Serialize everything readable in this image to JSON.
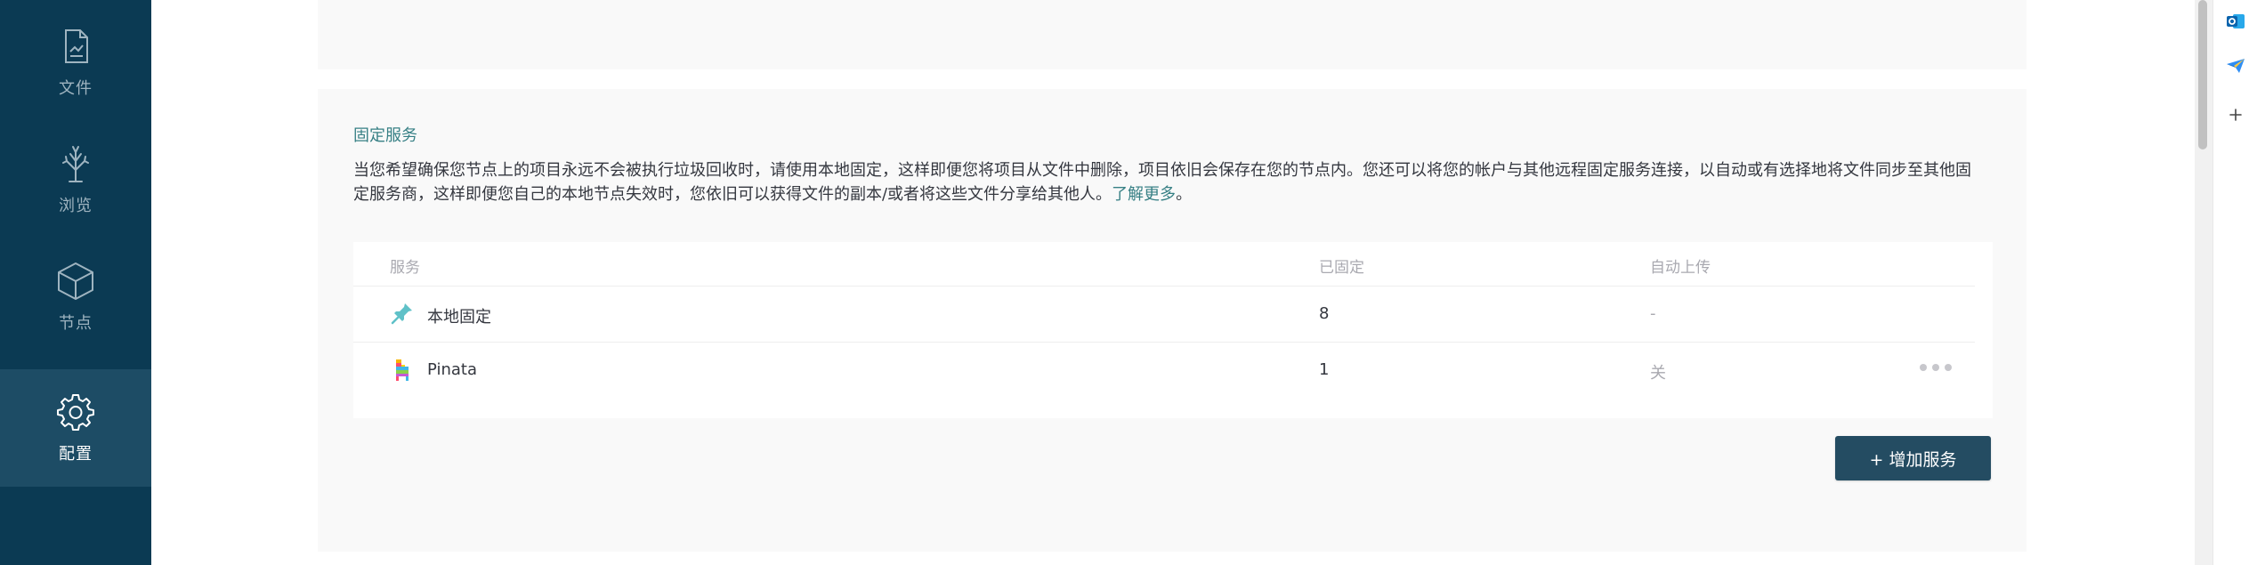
{
  "sidebar": {
    "items": [
      {
        "label": "文件",
        "icon": "file-icon"
      },
      {
        "label": "浏览",
        "icon": "tree-icon"
      },
      {
        "label": "节点",
        "icon": "cube-icon"
      },
      {
        "label": "配置",
        "icon": "gear-icon",
        "active": true
      }
    ]
  },
  "pinning": {
    "title": "固定服务",
    "description": "当您希望确保您节点上的项目永远不会被执行垃圾回收时，请使用本地固定，这样即便您将项目从文件中删除，项目依旧会保存在您的节点内。您还可以将您的帐户与其他远程固定服务连接，以自动或有选择地将文件同步至其他固定服务商，这样即便您自己的本地节点失效时，您依旧可以获得文件的副本/或者将这些文件分享给其他人。",
    "learn_more": "了解更多",
    "period": "。",
    "columns": {
      "service": "服务",
      "pinned": "已固定",
      "auto_upload": "自动上传"
    },
    "rows": [
      {
        "service": "本地固定",
        "pinned": "8",
        "auto_upload": "-",
        "icon": "pin-icon"
      },
      {
        "service": "Pinata",
        "pinned": "1",
        "auto_upload": "关",
        "icon": "pinata-icon"
      }
    ],
    "add_button": "+ 增加服务"
  },
  "edgebar": {
    "icons": [
      "outlook-icon",
      "paper-plane-icon",
      "plus-icon"
    ]
  },
  "colors": {
    "sidebar": "#0b3a53",
    "sidebar_active": "#1d4c65",
    "accent": "#378085",
    "button": "#244c62"
  }
}
